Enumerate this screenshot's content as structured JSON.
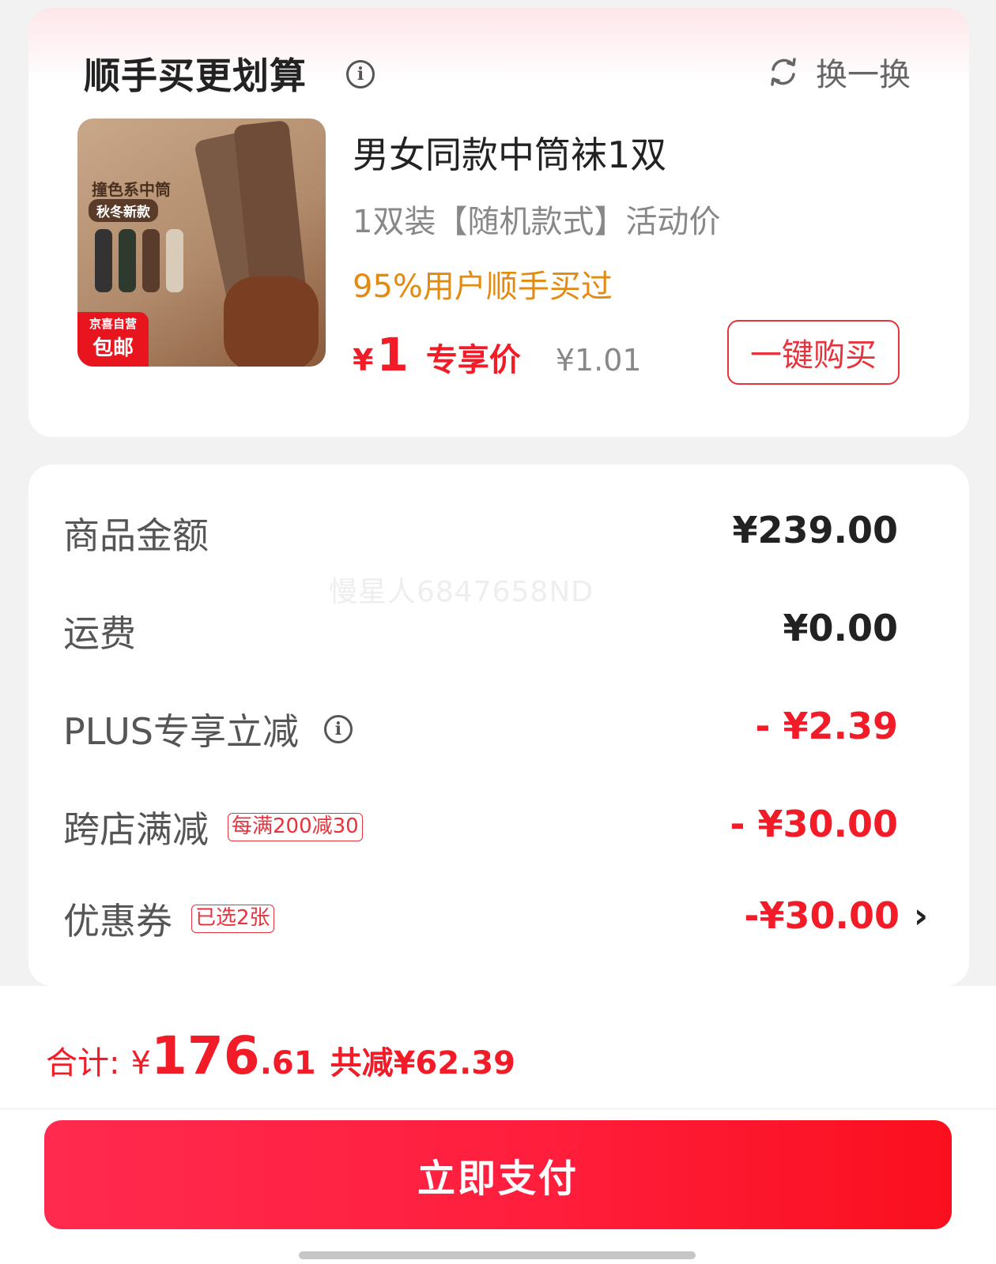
{
  "recommend": {
    "title": "顺手买更划算",
    "info_icon": "info-icon",
    "swap_label": "换一换",
    "swap_icon": "refresh-icon",
    "product": {
      "image_text_line1": "撞色系中筒",
      "image_text_line2": "秋冬新款",
      "image_badge_line1": "京喜自营",
      "image_badge_line2": "包邮",
      "name": "男女同款中筒袜1双",
      "subtitle": "1双装【随机款式】活动价",
      "hint": "95%用户顺手买过",
      "price_symbol": "¥",
      "price": "1",
      "price_tag": "专享价",
      "original_price": "¥1.01",
      "buy_button": "一键购买"
    }
  },
  "summary": {
    "watermark": "慢星人6847658ND",
    "rows": [
      {
        "label": "商品金额",
        "value": "¥239.00"
      },
      {
        "label": "运费",
        "value": "¥0.00"
      },
      {
        "label": "PLUS专享立减",
        "value": "- ¥2.39"
      },
      {
        "label": "跨店满减",
        "tag": "每满200减30",
        "value": "- ¥30.00"
      },
      {
        "label": "优惠券",
        "tag": "已选2张",
        "value": "-¥30.00",
        "chevron": "›"
      }
    ]
  },
  "footer": {
    "total_label": "合计:",
    "total_symbol": "¥",
    "total_int": "176",
    "total_dec": ".61",
    "total_saved": "共减¥62.39",
    "pay_button": "立即支付"
  },
  "colors": {
    "accent_red": "#f21c28",
    "hint_orange": "#e38a10",
    "pay_gradient_start": "#ff2a4f",
    "pay_gradient_end": "#fa0f1e"
  }
}
